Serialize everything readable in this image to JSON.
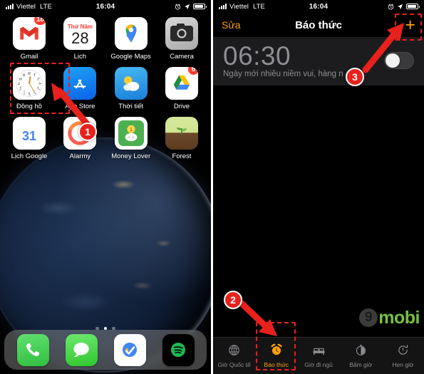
{
  "left_phone": {
    "status_bar": {
      "carrier": "Viettel",
      "network": "LTE",
      "time": "16:04",
      "signal_icon": "signal-bars-icon",
      "alarm_icon": "alarm-clock-icon",
      "location_icon": "location-arrow-icon",
      "battery_icon": "battery-icon"
    },
    "apps": [
      [
        {
          "label": "Gmail",
          "icon": "gmail-icon",
          "badge": "18"
        },
        {
          "label": "Lịch",
          "icon": "calendar-icon",
          "cal_dow": "Thứ Năm",
          "cal_day": "28",
          "badge": ""
        },
        {
          "label": "Google Maps",
          "icon": "google-maps-icon",
          "badge": ""
        },
        {
          "label": "Camera",
          "icon": "camera-icon",
          "badge": ""
        }
      ],
      [
        {
          "label": "Đồng hồ",
          "icon": "clock-icon",
          "badge": ""
        },
        {
          "label": "App Store",
          "icon": "app-store-icon",
          "badge": ""
        },
        {
          "label": "Thời tiết",
          "icon": "weather-icon",
          "badge": ""
        },
        {
          "label": "Drive",
          "icon": "google-drive-icon",
          "badge": "6"
        }
      ],
      [
        {
          "label": "Lịch Google",
          "icon": "google-calendar-icon",
          "cal_day": "31",
          "badge": ""
        },
        {
          "label": "Alarmy",
          "icon": "alarmy-icon",
          "badge": ""
        },
        {
          "label": "Money Lover",
          "icon": "money-lover-icon",
          "badge": ""
        },
        {
          "label": "Forest",
          "icon": "forest-icon",
          "badge": ""
        }
      ]
    ],
    "page_dots": {
      "count": 3,
      "active_index": 1
    },
    "dock": [
      {
        "label": "Phone",
        "icon": "phone-icon"
      },
      {
        "label": "Messages",
        "icon": "messages-icon"
      },
      {
        "label": "Google Tasks",
        "icon": "google-tasks-icon"
      },
      {
        "label": "Spotify",
        "icon": "spotify-icon"
      }
    ]
  },
  "right_phone": {
    "status_bar": {
      "carrier": "Viettel",
      "network": "LTE",
      "time": "16:04",
      "signal_icon": "signal-bars-icon",
      "alarm_icon": "alarm-clock-icon",
      "location_icon": "location-arrow-icon",
      "battery_icon": "battery-icon"
    },
    "navbar": {
      "edit_label": "Sửa",
      "title": "Báo thức",
      "add_label": "+",
      "accent_color": "#ff9f0a"
    },
    "alarms": [
      {
        "time": "06:30",
        "label": "Ngày mới nhiều niềm vui, hàng n",
        "enabled": false,
        "toggle_icon": "toggle-switch-off-icon"
      }
    ],
    "watermark": {
      "badge": "9",
      "text": "mobi",
      "color": "#77c043"
    },
    "tabs": [
      {
        "label": "Giờ Quốc tế",
        "icon": "globe-icon",
        "active": false
      },
      {
        "label": "Báo thức",
        "icon": "alarm-clock-icon",
        "active": true
      },
      {
        "label": "Giờ đi ngủ",
        "icon": "bed-icon",
        "active": false
      },
      {
        "label": "Bấm giờ",
        "icon": "stopwatch-icon",
        "active": false
      },
      {
        "label": "Hẹn giờ",
        "icon": "timer-icon",
        "active": false
      }
    ]
  },
  "annotations": {
    "marker_1": "1",
    "marker_2": "2",
    "marker_3": "3",
    "highlight_color": "#e8211c"
  }
}
